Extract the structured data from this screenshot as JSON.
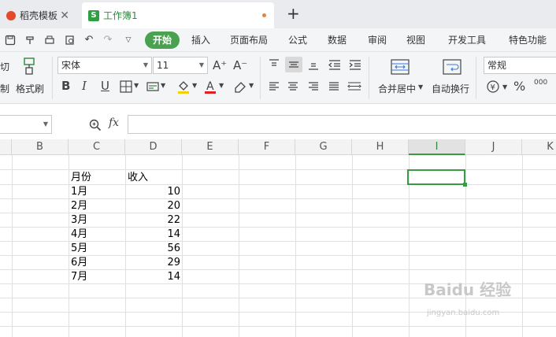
{
  "tabs": [
    {
      "label": "稻壳模板",
      "close": "✕"
    },
    {
      "label": "工作簿1",
      "logo": "S"
    }
  ],
  "tab_add": "+",
  "menu": {
    "active": "开始",
    "items": [
      "插入",
      "页面布局",
      "公式",
      "数据",
      "审阅",
      "视图",
      "开发工具",
      "特色功能"
    ]
  },
  "toolbar": {
    "cut_label": "切",
    "cut_label2": "制",
    "format_painter": "格式刷",
    "font_name": "宋体",
    "font_size": "11",
    "bold": "B",
    "italic": "I",
    "underline": "U",
    "merge_center": "合并居中",
    "wrap_text": "自动换行",
    "number_format": "常规",
    "currency": "¥",
    "percent": "%",
    "thousands": "000"
  },
  "formula": {
    "fx": "fx"
  },
  "columns": [
    "B",
    "C",
    "D",
    "E",
    "F",
    "G",
    "H",
    "I",
    "J",
    "K"
  ],
  "selected_column": "I",
  "sheet": {
    "headers": [
      "月份",
      "收入"
    ],
    "rows": [
      {
        "month": "1月",
        "value": "10"
      },
      {
        "month": "2月",
        "value": "20"
      },
      {
        "month": "3月",
        "value": "22"
      },
      {
        "month": "4月",
        "value": "14"
      },
      {
        "month": "5月",
        "value": "56"
      },
      {
        "month": "6月",
        "value": "29"
      },
      {
        "month": "7月",
        "value": "14"
      }
    ]
  },
  "watermark": {
    "main": "Baidu 经验",
    "sub": "jingyan.baidu.com"
  },
  "colors": {
    "accent": "#4aa14f",
    "selection": "#3b9a45"
  }
}
